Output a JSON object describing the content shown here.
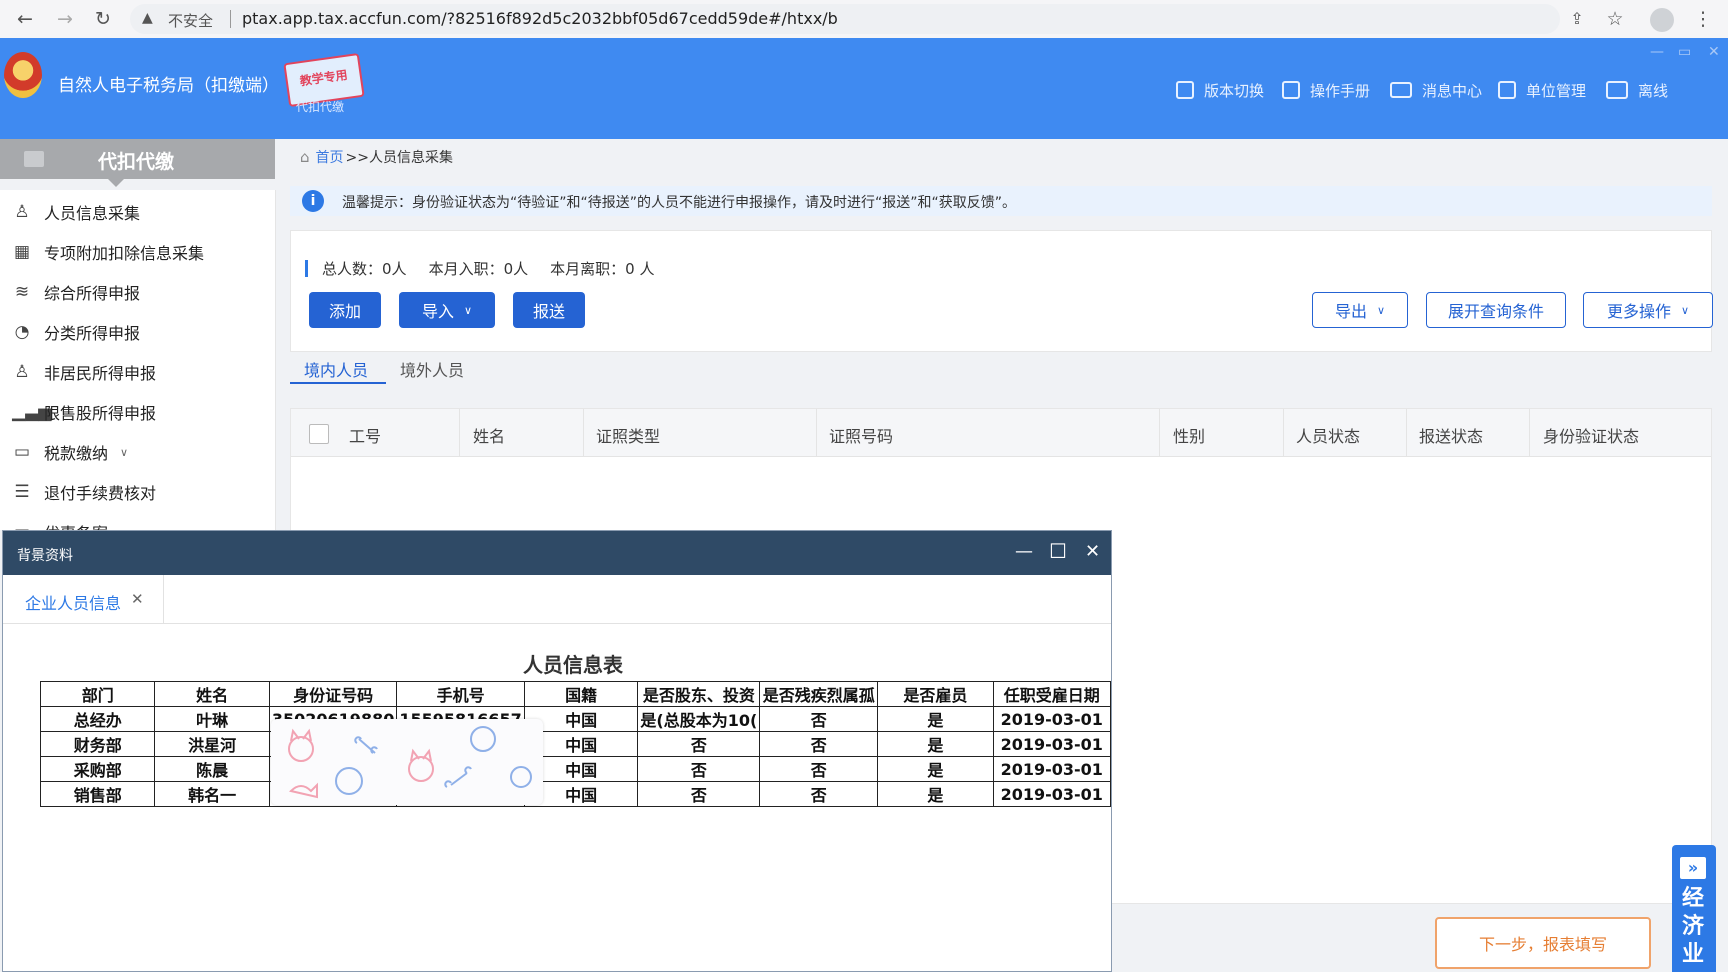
{
  "browser": {
    "insecure_label": "不安全",
    "url": "ptax.app.tax.accfun.com/?82516f892d5c2032bbf05d67cedd59de#/htxx/b"
  },
  "header": {
    "title": "自然人电子税务局（扣缴端）",
    "stamp_text": "教学专用",
    "stamp_sub": "代扣代缴",
    "nav": [
      {
        "label": "版本切换",
        "icon": "document-icon"
      },
      {
        "label": "操作手册",
        "icon": "manual-icon"
      },
      {
        "label": "消息中心",
        "icon": "mail-icon"
      },
      {
        "label": "单位管理",
        "icon": "building-icon"
      },
      {
        "label": "离线",
        "icon": "offline-icon"
      }
    ]
  },
  "sidebar": {
    "section_title": "代扣代缴",
    "items": [
      {
        "label": "人员信息采集",
        "icon": "person-icon"
      },
      {
        "label": "专项附加扣除信息采集",
        "icon": "grid-icon"
      },
      {
        "label": "综合所得申报",
        "icon": "layers-icon"
      },
      {
        "label": "分类所得申报",
        "icon": "pie-icon"
      },
      {
        "label": "非居民所得申报",
        "icon": "person-outline-icon"
      },
      {
        "label": "限售股所得申报",
        "icon": "bar-chart-icon"
      },
      {
        "label": "税款缴纳",
        "icon": "wallet-icon"
      },
      {
        "label": "退付手续费核对",
        "icon": "list-icon"
      },
      {
        "label": "优惠备案",
        "icon": "folder-icon"
      }
    ]
  },
  "breadcrumb": {
    "home": "首页",
    "current": ">>人员信息采集"
  },
  "notice": "温馨提示：身份验证状态为“待验证”和“待报送”的人员不能进行申报操作，请及时进行“报送”和“获取反馈”。",
  "stats": {
    "total_label": "总人数：",
    "total_value": "0人",
    "joined_label": "本月入职：",
    "joined_value": "0人",
    "left_label": "本月离职：",
    "left_value": "0 人"
  },
  "toolbar": {
    "add": "添加",
    "import": "导入",
    "submit": "报送",
    "export": "导出",
    "expand_query": "展开查询条件",
    "more": "更多操作"
  },
  "tabs": {
    "domestic": "境内人员",
    "foreign": "境外人员"
  },
  "table_headers": [
    "工号",
    "姓名",
    "证照类型",
    "证照号码",
    "性别",
    "人员状态",
    "报送状态",
    "身份验证状态"
  ],
  "next_button": "下一步，报表填写",
  "side_widget": {
    "text": "经济业"
  },
  "modal": {
    "title": "背景资料",
    "tab_label": "企业人员信息",
    "doc_title": "人员信息表",
    "columns": [
      "部门",
      "姓名",
      "身份证号码",
      "手机号",
      "国籍",
      "是否股东、投资",
      "是否残疾烈属孤",
      "是否雇员",
      "任职受雇日期"
    ],
    "rows": [
      [
        "总经办",
        "叶琳",
        "35020619880",
        "15595816657",
        "中国",
        "是(总股本为10(",
        "否",
        "是",
        "2019-03-01"
      ],
      [
        "财务部",
        "洪星河",
        "",
        "",
        "中国",
        "否",
        "否",
        "是",
        "2019-03-01"
      ],
      [
        "采购部",
        "陈晨",
        "",
        "",
        "中国",
        "否",
        "否",
        "是",
        "2019-03-01"
      ],
      [
        "销售部",
        "韩名一",
        "",
        "",
        "中国",
        "否",
        "否",
        "是",
        "2019-03-01"
      ]
    ]
  },
  "colors": {
    "header_blue": "#3f8af1",
    "primary": "#2563d3",
    "modal_title": "#2f4a66",
    "next_button": "#e67e33"
  }
}
